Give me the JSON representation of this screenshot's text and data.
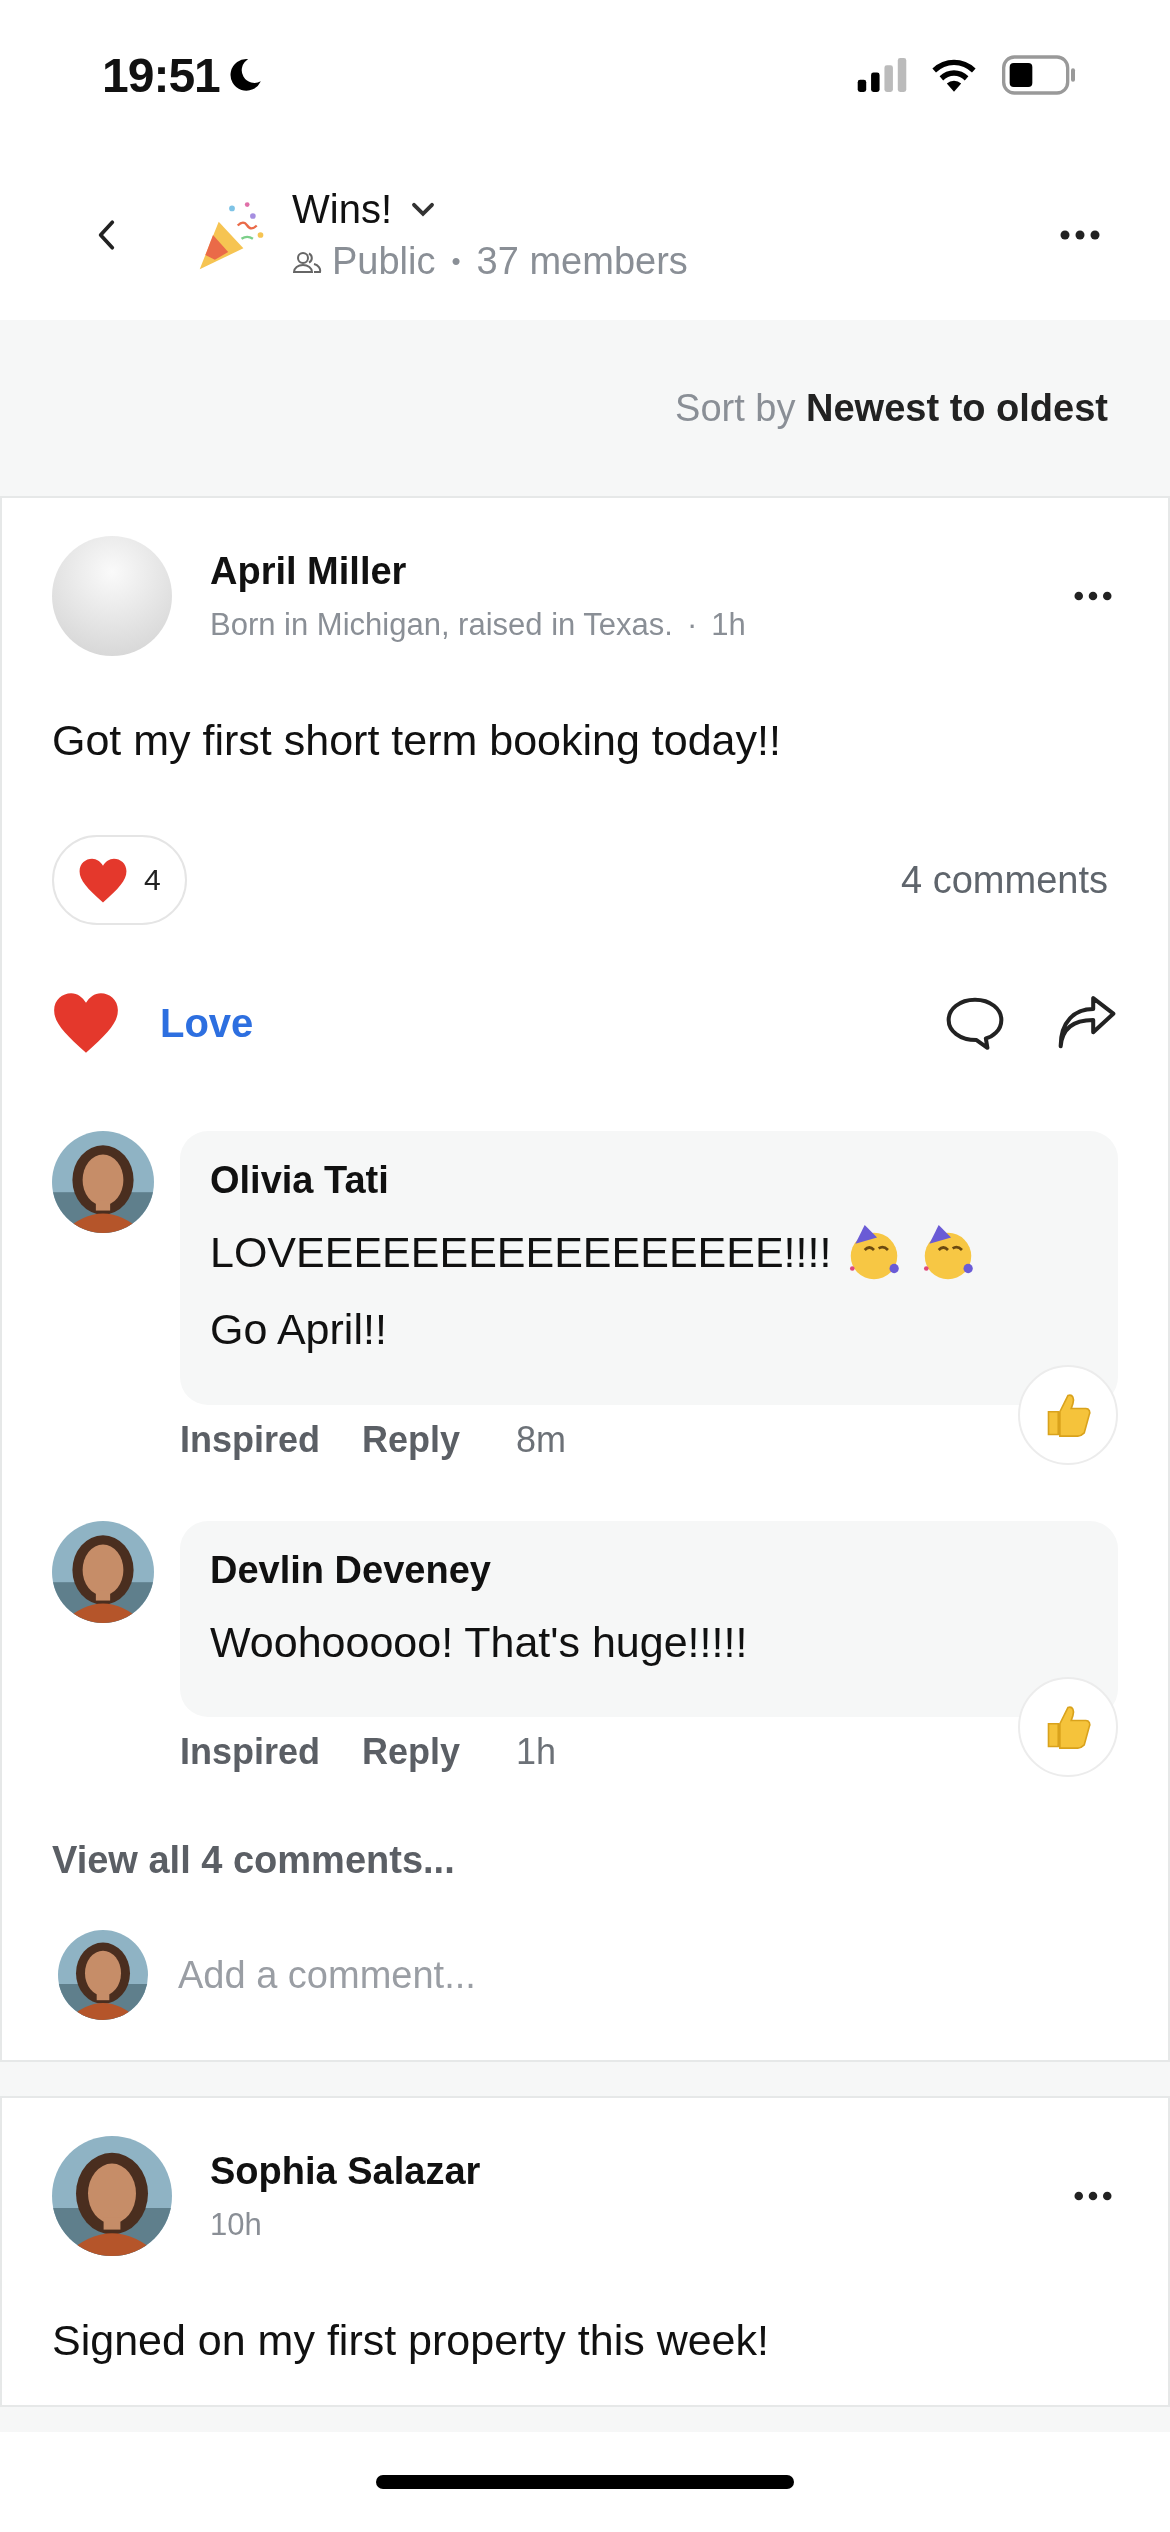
{
  "status_bar": {
    "time": "19:51"
  },
  "header": {
    "title": "Wins!",
    "visibility": "Public",
    "separator": "•",
    "members": "37 members"
  },
  "sort": {
    "label": "Sort by",
    "value": "Newest to oldest"
  },
  "posts": [
    {
      "author": "April Miller",
      "bio": "Born in Michigan, raised in Texas.",
      "separator": "·",
      "time": "1h",
      "avatar": {
        "kind": "blank"
      },
      "text": "Got my first short term booking today!!",
      "reaction_count": "4",
      "comments_count": "4 comments",
      "love": {
        "label": "Love",
        "selected": true
      },
      "comments": [
        {
          "author": "Olivia Tati",
          "avatar": {
            "kind": "picture"
          },
          "segments": [
            {
              "kind": "text",
              "text": "LOVEEEEEEEEEEEEEEEEE!!!!"
            },
            {
              "kind": "party-face"
            },
            {
              "kind": "party-face"
            },
            {
              "kind": "text",
              "text": "Go April!!"
            }
          ],
          "reaction_label": "Inspired",
          "reply": "Reply",
          "time": "8m"
        },
        {
          "author": "Devlin Deveney",
          "avatar": {
            "kind": "picture"
          },
          "segments": [
            {
              "kind": "text",
              "text": "Woohooooo! That's huge!!!!!"
            }
          ],
          "reaction_label": "Inspired",
          "reply": "Reply",
          "time": "1h"
        }
      ],
      "view_all": "View all 4 comments...",
      "add_comment": {
        "placeholder": "Add a comment..."
      }
    },
    {
      "author": "Sophia Salazar",
      "time": "10h",
      "avatar": {
        "kind": "picture"
      },
      "text": "Signed on my first property this week!"
    }
  ]
}
